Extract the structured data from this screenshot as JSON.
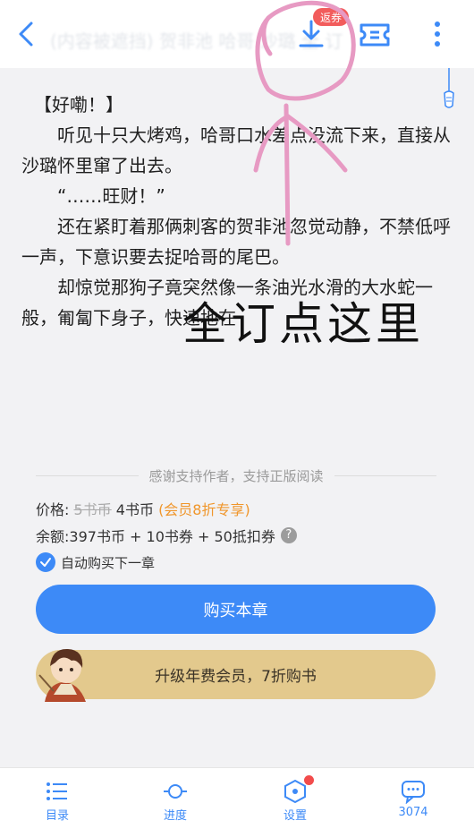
{
  "header": {
    "faded_title": "(内容被遮挡) 贺非池 哈哥 沙璐 全 订",
    "badge": "返券",
    "icons": [
      "back-icon",
      "download-icon",
      "ticket-icon",
      "more-icon",
      "pull-cord-icon"
    ]
  },
  "content": {
    "paragraphs": [
      "【好嘞！】",
      "听见十只大烤鸡，哈哥口水差点没流下来，直接从沙璐怀里窜了出去。",
      "“……旺财！”",
      "还在紧盯着那俩刺客的贺非池忽觉动静，不禁低呼一声，下意识要去捉哈哥的尾巴。",
      "却惊觉那狗子竟突然像一条油光水滑的大水蛇一般，匍匐下身子，快速地在"
    ]
  },
  "overlay": {
    "handwritten_text": "全订点这里",
    "stroke_color": "#e79ac3"
  },
  "purchase": {
    "divider_text": "感谢支持作者，支持正版阅读",
    "price_label": "价格:",
    "price_original": "5书币",
    "price_now": "4书币",
    "price_note": "(会员8折专享)",
    "balance_label": "余额:",
    "balance_value": "397书币 + 10书券 + 50抵扣券",
    "help": "?",
    "auto_buy": "自动购买下一章",
    "buy_button": "购买本章",
    "vip_button": "升级年费会员，7折购书",
    "accent_color": "#3d8af7",
    "vip_color": "#e3c98d"
  },
  "bottom_nav": {
    "items": [
      {
        "label": "目录",
        "icon": "catalog-icon"
      },
      {
        "label": "进度",
        "icon": "progress-icon"
      },
      {
        "label": "设置",
        "icon": "settings-icon"
      },
      {
        "label": "3074",
        "icon": "comments-icon"
      }
    ]
  }
}
